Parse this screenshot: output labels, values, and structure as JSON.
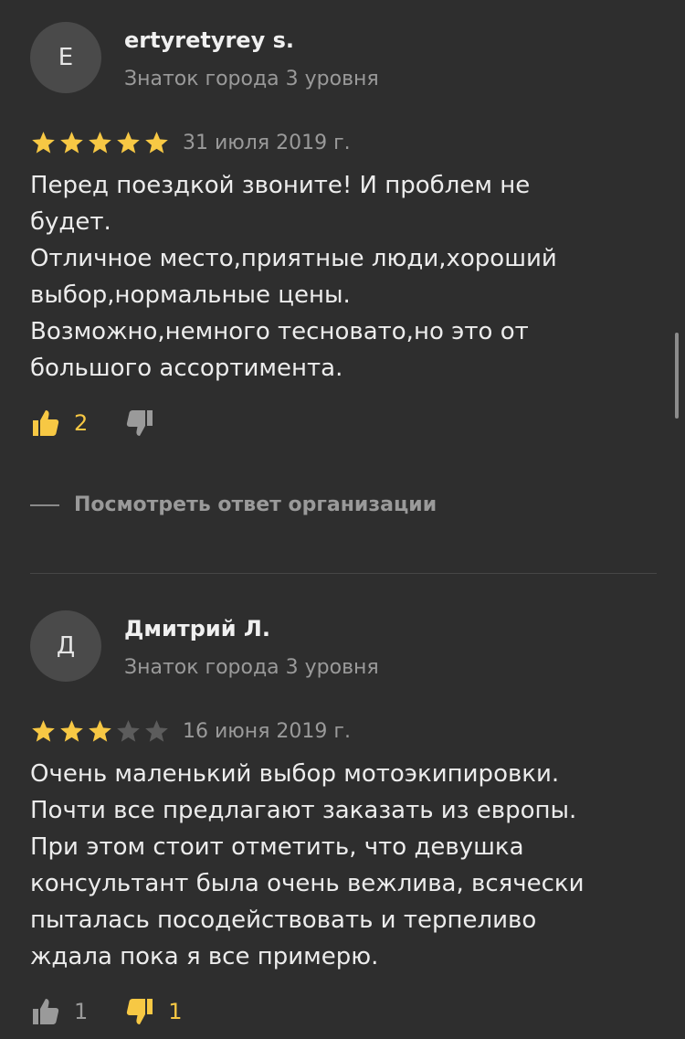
{
  "reviews": [
    {
      "avatar_letter": "E",
      "author": "ertyretyrey s.",
      "level": "Знаток города 3 уровня",
      "rating": 5,
      "date": "31 июля 2019 г.",
      "text": "Перед поездкой звоните! И проблем не\nбудет.\nОтличное место,приятные люди,хороший\nвыбор,нормальные цены.\nВозможно,немного тесновато,но это от\nбольшого ассортимента.",
      "likes": "2",
      "dislikes": "",
      "org_reply_label": "Посмотреть ответ организации"
    },
    {
      "avatar_letter": "Д",
      "author": "Дмитрий Л.",
      "level": "Знаток города 3 уровня",
      "rating": 3,
      "date": "16 июня 2019 г.",
      "text": "Очень маленький выбор мотоэкипировки.\nПочти все предлагают заказать из европы.\nПри этом стоит отметить, что девушка\nконсультант была очень вежлива, всячески\nпыталась посодействовать и терпеливо\nждала пока я все примерю.",
      "likes": "1",
      "dislikes": "1"
    }
  ],
  "colors": {
    "background": "#2e2e2e",
    "star_filled": "#f7c844",
    "star_empty": "#5c5c5c",
    "active_reaction": "#f7c844",
    "inactive_reaction": "#9a9a9a"
  },
  "icons": {
    "like": "thumbs-up-icon",
    "dislike": "thumbs-down-icon",
    "star": "star-icon"
  }
}
